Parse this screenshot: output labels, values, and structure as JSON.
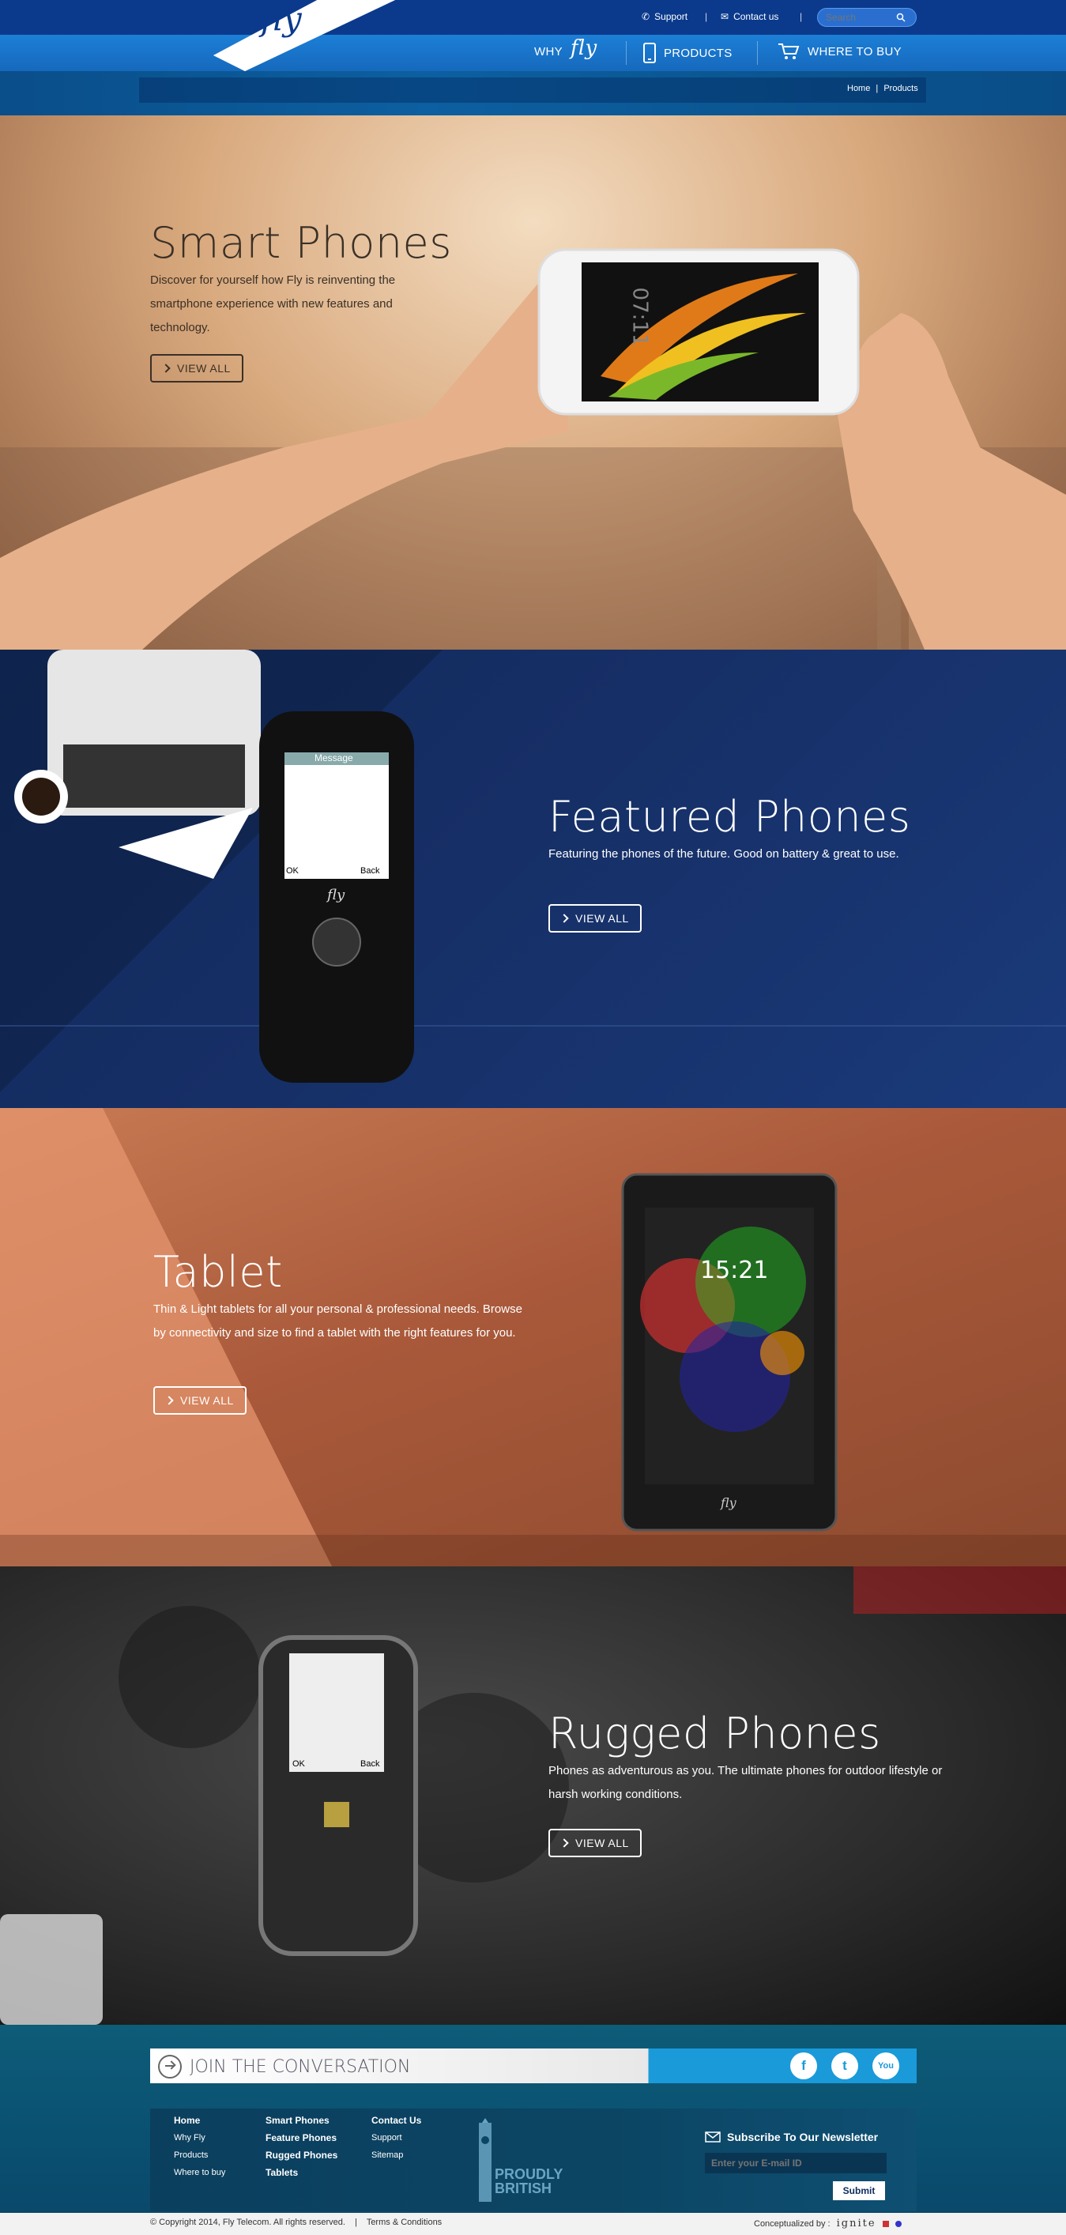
{
  "header": {
    "logo_text": "fly",
    "support_label": "Support",
    "contact_label": "Contact us",
    "search_placeholder": "Search",
    "nav": {
      "why_label": "WHY",
      "why_logo": "fly",
      "products_label": "PRODUCTS",
      "where_label": "WHERE TO BUY"
    },
    "breadcrumb": {
      "home": "Home",
      "separator": "|",
      "current": "Products"
    }
  },
  "sections": [
    {
      "title": "Smart Phones",
      "description": "Discover for yourself how Fly is reinventing the smartphone experience with new features and technology.",
      "button": "VIEW ALL",
      "phone_time": "07:11"
    },
    {
      "title": "Featured Phones",
      "description": "Featuring the phones of the future. Good on battery & great to use.",
      "button": "VIEW ALL",
      "screen_title": "Message",
      "softkey_left": "OK",
      "softkey_right": "Back",
      "brand": "fly"
    },
    {
      "title": "Tablet",
      "description": "Thin & Light tablets for all your personal & professional needs. Browse by connectivity and size to find a tablet with the right features for you.",
      "button": "VIEW ALL",
      "tablet_time": "15:21",
      "brand": "fly"
    },
    {
      "title": "Rugged Phones",
      "description": "Phones as adventurous as you. The ultimate phones for outdoor lifestyle or harsh working conditions.",
      "button": "VIEW ALL",
      "softkey_left": "OK",
      "softkey_right": "Back"
    }
  ],
  "footer": {
    "conversation": "JOIN THE CONVERSATION",
    "social": [
      "f",
      "t",
      "You"
    ],
    "columns": [
      {
        "heading": "Home",
        "items": [
          "Why Fly",
          "Products",
          "Where to buy"
        ]
      },
      {
        "heading": "Smart Phones",
        "items": [
          "Feature Phones",
          "Rugged Phones",
          "Tablets"
        ]
      },
      {
        "heading": "Contact Us",
        "items": [
          "Support",
          "Sitemap"
        ]
      }
    ],
    "british_line1": "PROUDLY",
    "british_line2": "BRITISH",
    "newsletter_heading": "Subscribe To Our Newsletter",
    "email_placeholder": "Enter your E-mail ID",
    "submit_label": "Submit",
    "copyright": "© Copyright 2014, Fly Telecom. All rights reserved.",
    "terms": "Terms & Conditions",
    "conceptualized_label": "Conceptualized by :",
    "agency": "ignite"
  },
  "colors": {
    "topbar": "#0b3a8c",
    "navbar": "#1c7fd6",
    "footer": "#0d5c78",
    "social_accent": "#1a9ad9"
  }
}
